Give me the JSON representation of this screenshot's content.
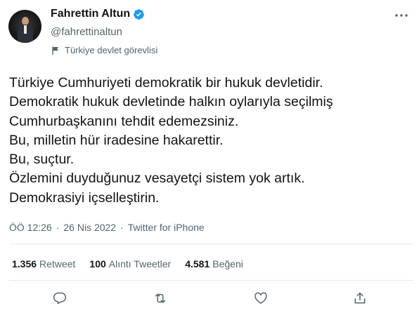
{
  "user": {
    "display_name": "Fahrettin Altun",
    "handle": "@fahrettinaltun",
    "account_label": "Türkiye devlet görevlisi"
  },
  "tweet": {
    "lines": [
      "Türkiye Cumhuriyeti demokratik bir hukuk devletidir.",
      "Demokratik hukuk devletinde halkın oylarıyla seçilmiş",
      "Cumhurbaşkanını tehdit edemezsiniz.",
      "Bu, milletin hür iradesine hakarettir.",
      "Bu, suçtur.",
      "Özlemini duyduğunuz vesayetçi sistem yok artık.",
      "Demokrasiyi içselleştirin."
    ],
    "time": "ÖÖ 12:26",
    "date": "26 Nis 2022",
    "separator": "·",
    "source": "Twitter for iPhone"
  },
  "stats": {
    "retweets_count": "1.356",
    "retweets_label": "Retweet",
    "quotes_count": "100",
    "quotes_label": "Alıntı Tweetler",
    "likes_count": "4.581",
    "likes_label": "Beğeni"
  },
  "icons": {
    "verified": "verified-badge-icon",
    "more": "more-options-icon",
    "flag": "government-flag-icon",
    "reply": "reply-icon",
    "retweet": "retweet-icon",
    "like": "heart-icon",
    "share": "share-icon"
  },
  "colors": {
    "verified_blue": "#1d9bf0",
    "secondary_text": "#536471",
    "primary_text": "#0f1419"
  }
}
